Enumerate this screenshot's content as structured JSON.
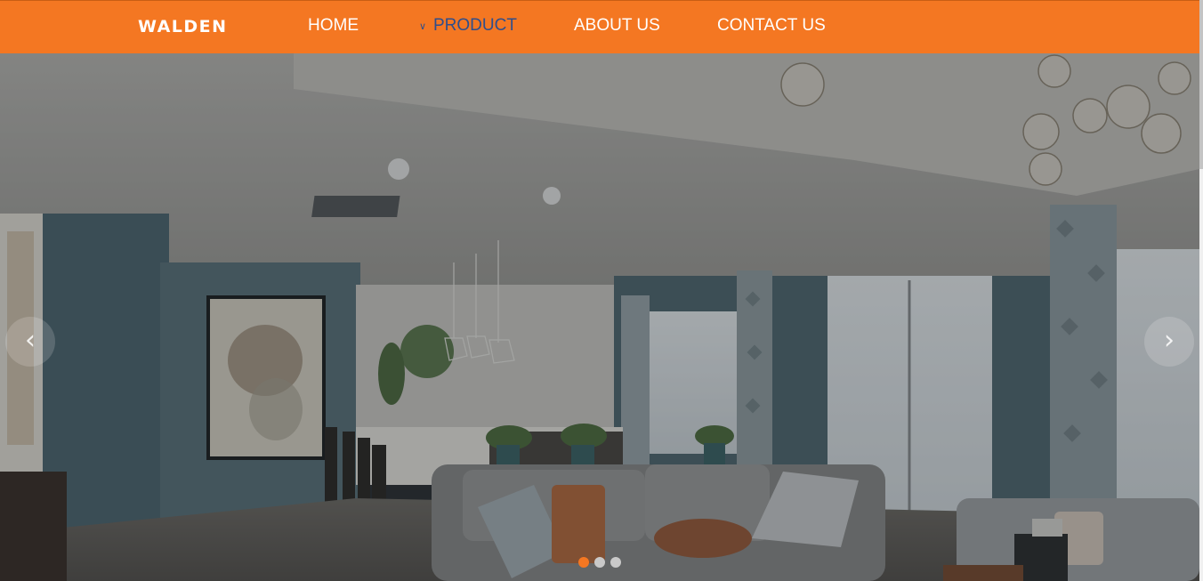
{
  "brand": {
    "logo_text": "WALDEN",
    "accent_color": "#f47722",
    "active_nav_color": "#2f4e8c"
  },
  "nav": {
    "items": [
      {
        "label": "HOME"
      },
      {
        "label": "PRODUCT",
        "active": true,
        "has_dropdown": true
      },
      {
        "label": "ABOUT US"
      },
      {
        "label": "CONTACT US"
      }
    ]
  },
  "slider": {
    "prev_icon": "chevron-left-icon",
    "next_icon": "chevron-right-icon",
    "active_slide": 1,
    "slide_count": 3
  }
}
